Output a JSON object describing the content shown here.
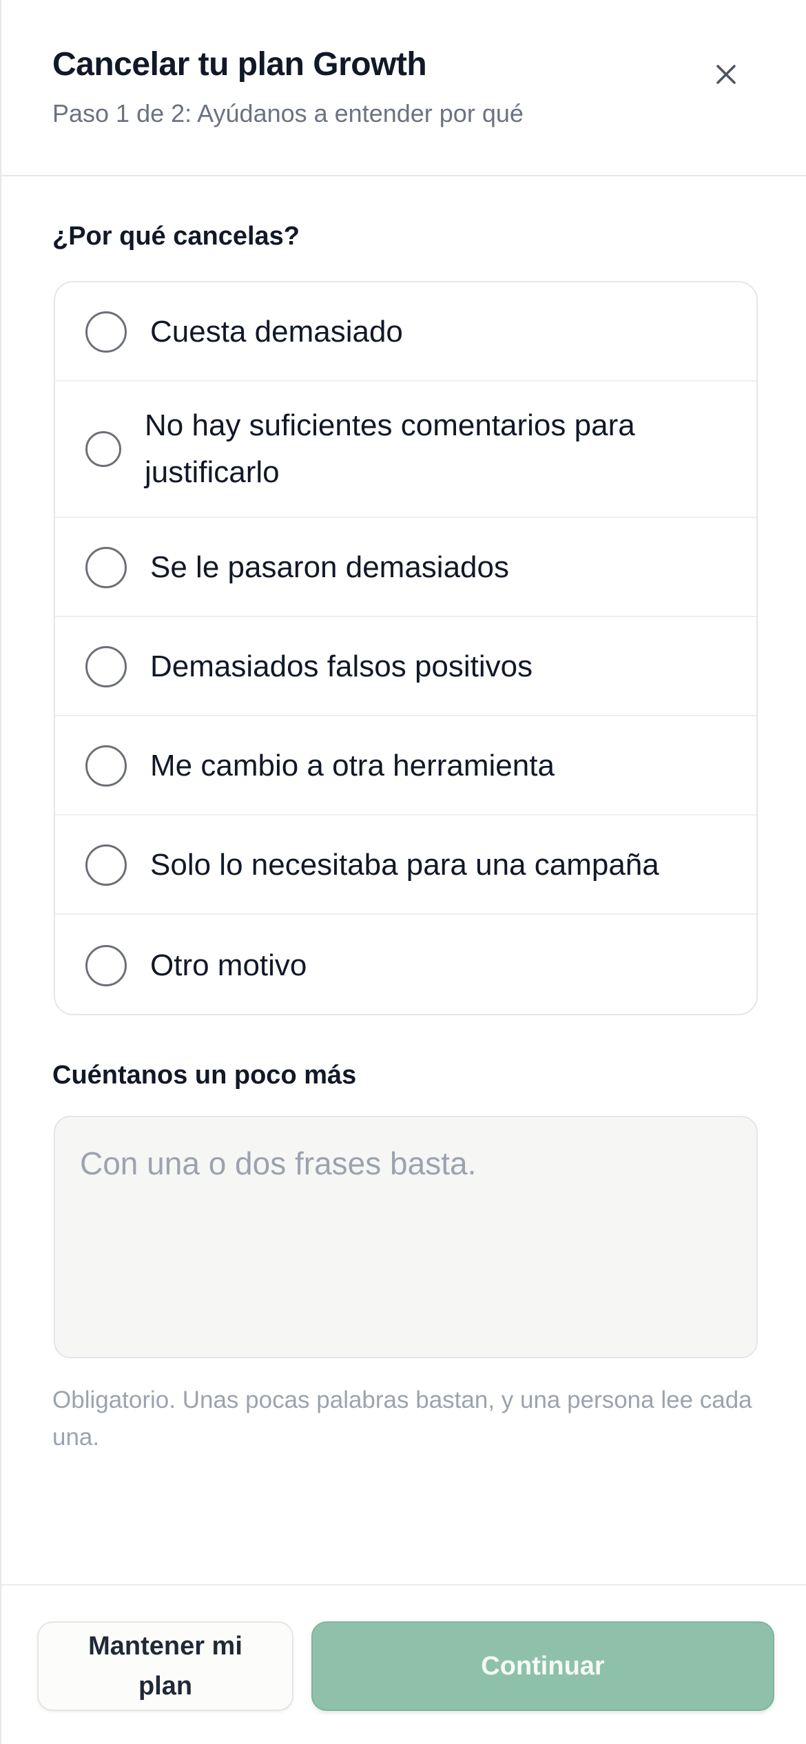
{
  "header": {
    "title": "Cancelar tu plan Growth",
    "subtitle": "Paso 1 de 2: Ayúdanos a entender por qué",
    "close_icon": "close-icon"
  },
  "question": {
    "label": "¿Por qué cancelas?",
    "options": [
      {
        "label": "Cuesta demasiado",
        "selected": false
      },
      {
        "label": "No hay suficientes comentarios para justificarlo",
        "selected": false
      },
      {
        "label": "Se le pasaron demasiados",
        "selected": false
      },
      {
        "label": "Demasiados falsos positivos",
        "selected": false
      },
      {
        "label": "Me cambio a otra herramienta",
        "selected": false
      },
      {
        "label": "Solo lo necesitaba para una campaña",
        "selected": false
      },
      {
        "label": "Otro motivo",
        "selected": false
      }
    ]
  },
  "details": {
    "label": "Cuéntanos un poco más",
    "value": "",
    "placeholder": "Con una o dos frases basta.",
    "help": "Obligatorio. Unas pocas palabras bastan, y una persona lee cada una."
  },
  "footer": {
    "keep_label": "Mantener mi plan",
    "continue_label": "Continuar"
  },
  "colors": {
    "accent": "#8fc1aa",
    "text": "#111827",
    "muted": "#6b7280"
  }
}
